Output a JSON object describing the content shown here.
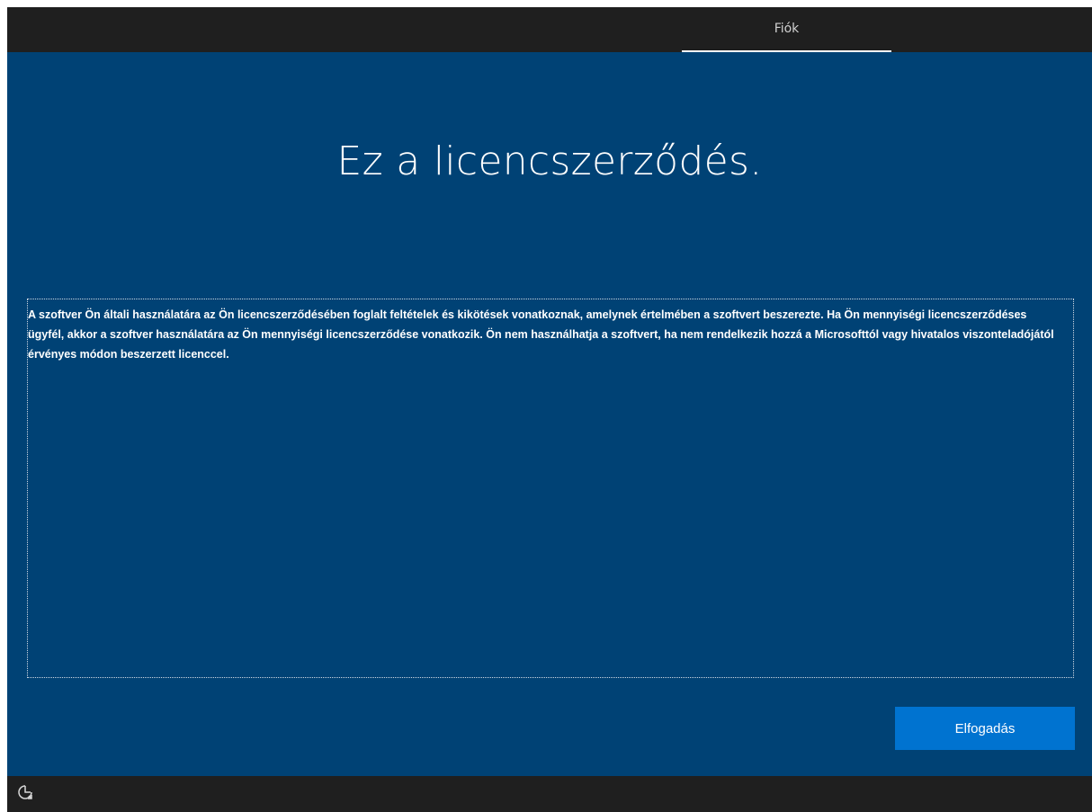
{
  "header": {
    "tab_label": "Fiók"
  },
  "main": {
    "title": "Ez a licencszerződés.",
    "license_text": "A szoftver Ön általi használatára az Ön licencszerződésében foglalt feltételek és kikötések vonatkoznak, amelynek értelmében a szoftvert beszerezte. Ha Ön mennyiségi licencszerződéses ügyfél, akkor a szoftver használatára az Ön mennyiségi licencszerződése vonatkozik. Ön nem használhatja a szoftvert, ha nem rendelkezik hozzá a Microsofttól vagy hivatalos viszonteladójától érvényes módon beszerzett licenccel.",
    "accept_label": "Elfogadás"
  },
  "footer": {
    "icon": "ease-of-access-icon"
  },
  "colors": {
    "background": "#004275",
    "chrome": "#1f1f1f",
    "accent": "#0073d0"
  }
}
